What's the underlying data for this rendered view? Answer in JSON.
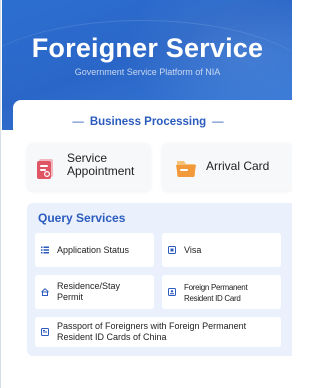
{
  "header": {
    "title": "Foreigner Service",
    "subtitle": "Government Service Platform of NIA"
  },
  "business": {
    "heading": "Business Processing",
    "dash_left": "—",
    "dash_right": "—",
    "cards": [
      {
        "label_line1": "Service",
        "label_line2": "Appointment",
        "icon": "calendar-icon"
      },
      {
        "label": "Arrival Card",
        "icon": "card-folder-icon"
      }
    ]
  },
  "query": {
    "heading": "Query Services",
    "items": [
      {
        "label": "Application Status",
        "icon": "list-icon"
      },
      {
        "label": "Visa",
        "icon": "visa-icon"
      },
      {
        "label_line1": "Residence/Stay",
        "label_line2": "Permit",
        "icon": "residence-icon"
      },
      {
        "label_line1": "Foreign Permanent",
        "label_line2": "Resident ID Card",
        "icon": "id-card-icon"
      },
      {
        "label_line1": "Passport of Foreigners with Foreign Permanent",
        "label_line2": "Resident ID Cards of China",
        "icon": "passport-icon"
      }
    ]
  },
  "colors": {
    "header_blue": "#2a66c7",
    "accent_blue": "#2a5bbd",
    "query_bg": "#eaf1fd",
    "appointment_red": "#e05563",
    "arrival_orange": "#f29a3b"
  }
}
